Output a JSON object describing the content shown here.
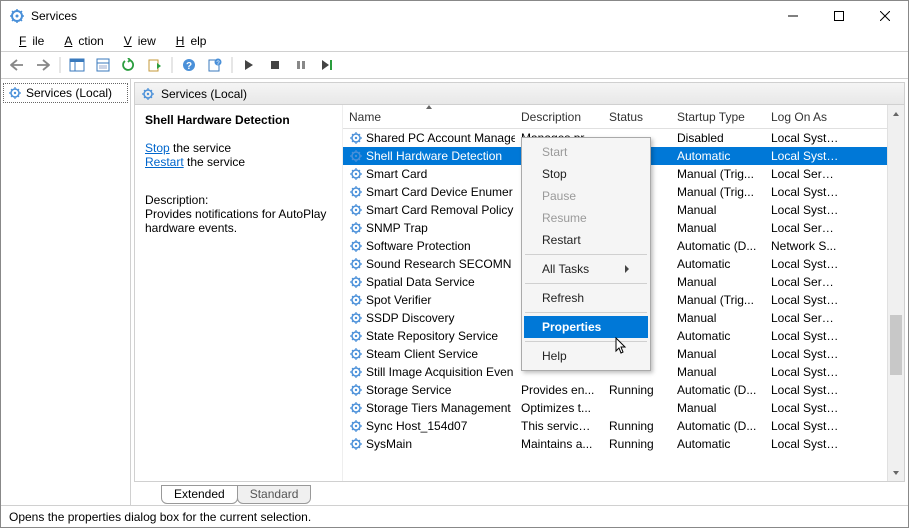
{
  "window": {
    "title": "Services"
  },
  "menu": {
    "file": "File",
    "action": "Action",
    "view": "View",
    "help": "Help"
  },
  "leftpane": {
    "node": "Services (Local)"
  },
  "pane": {
    "header": "Services (Local)"
  },
  "detail": {
    "service_name": "Shell Hardware Detection",
    "stop_link": "Stop",
    "stop_suffix": " the service",
    "restart_link": "Restart",
    "restart_suffix": " the service",
    "desc_label": "Description:",
    "desc_text": "Provides notifications for AutoPlay hardware events."
  },
  "columns": {
    "name": "Name",
    "desc": "Description",
    "status": "Status",
    "startup": "Startup Type",
    "logon": "Log On As"
  },
  "rows": [
    {
      "name": "Shared PC Account Manager",
      "desc": "Manages pr...",
      "status": "",
      "startup": "Disabled",
      "logon": "Local Syste..."
    },
    {
      "name": "Shell Hardware Detection",
      "desc": "",
      "status": "",
      "startup": "Automatic",
      "logon": "Local Syste...",
      "selected": true
    },
    {
      "name": "Smart Card",
      "desc": "",
      "status": "",
      "startup": "Manual (Trig...",
      "logon": "Local Service"
    },
    {
      "name": "Smart Card Device Enumer",
      "desc": "",
      "status": "",
      "startup": "Manual (Trig...",
      "logon": "Local Syste..."
    },
    {
      "name": "Smart Card Removal Policy",
      "desc": "",
      "status": "",
      "startup": "Manual",
      "logon": "Local Syste..."
    },
    {
      "name": "SNMP Trap",
      "desc": "",
      "status": "",
      "startup": "Manual",
      "logon": "Local Service"
    },
    {
      "name": "Software Protection",
      "desc": "",
      "status": "",
      "startup": "Automatic (D...",
      "logon": "Network S..."
    },
    {
      "name": "Sound Research SECOMN S",
      "desc": "",
      "status": "",
      "startup": "Automatic",
      "logon": "Local Syste..."
    },
    {
      "name": "Spatial Data Service",
      "desc": "",
      "status": "",
      "startup": "Manual",
      "logon": "Local Service"
    },
    {
      "name": "Spot Verifier",
      "desc": "",
      "status": "",
      "startup": "Manual (Trig...",
      "logon": "Local Syste..."
    },
    {
      "name": "SSDP Discovery",
      "desc": "",
      "status": "",
      "startup": "Manual",
      "logon": "Local Service"
    },
    {
      "name": "State Repository Service",
      "desc": "",
      "status": "",
      "startup": "Automatic",
      "logon": "Local Syste..."
    },
    {
      "name": "Steam Client Service",
      "desc": "",
      "status": "",
      "startup": "Manual",
      "logon": "Local Syste..."
    },
    {
      "name": "Still Image Acquisition Even",
      "desc": "",
      "status": "",
      "startup": "Manual",
      "logon": "Local Syste..."
    },
    {
      "name": "Storage Service",
      "desc": "Provides en...",
      "status": "Running",
      "startup": "Automatic (D...",
      "logon": "Local Syste..."
    },
    {
      "name": "Storage Tiers Management",
      "desc": "Optimizes t...",
      "status": "",
      "startup": "Manual",
      "logon": "Local Syste..."
    },
    {
      "name": "Sync Host_154d07",
      "desc": "This service ...",
      "status": "Running",
      "startup": "Automatic (D...",
      "logon": "Local Syste..."
    },
    {
      "name": "SysMain",
      "desc": "Maintains a...",
      "status": "Running",
      "startup": "Automatic",
      "logon": "Local Syste..."
    }
  ],
  "ctx": {
    "start": "Start",
    "stop": "Stop",
    "pause": "Pause",
    "resume": "Resume",
    "restart": "Restart",
    "alltasks": "All Tasks",
    "refresh": "Refresh",
    "properties": "Properties",
    "help": "Help"
  },
  "tabs": {
    "extended": "Extended",
    "standard": "Standard"
  },
  "statusbar": "Opens the properties dialog box for the current selection."
}
